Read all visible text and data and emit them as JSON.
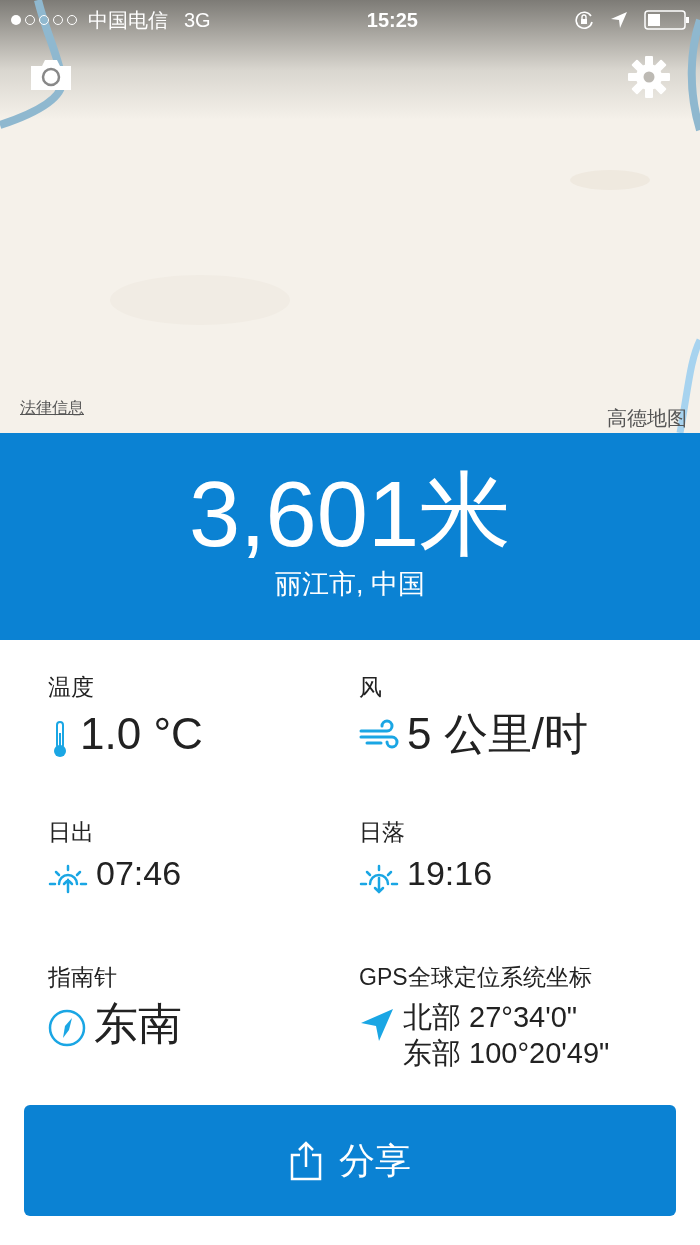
{
  "status_bar": {
    "carrier": "中国电信",
    "network": "3G",
    "time": "15:25"
  },
  "map": {
    "kind": "picture",
    "legal_link": "法律信息",
    "provider_logo": "高德地图"
  },
  "altitude": {
    "value": "3,601米",
    "location": "丽江市, 中国"
  },
  "stats": [
    {
      "kind": "temperature",
      "label": "温度",
      "values": [
        "1.0 °C"
      ]
    },
    {
      "kind": "wind",
      "label": "风",
      "values": [
        "5 公里/时"
      ]
    },
    {
      "kind": "sunrise",
      "label": "日出",
      "values": [
        "07:46"
      ]
    },
    {
      "kind": "sunset",
      "label": "日落",
      "values": [
        "19:16"
      ]
    },
    {
      "kind": "compass",
      "label": "指南针",
      "values": [
        "东南"
      ]
    },
    {
      "kind": "gps",
      "label": "GPS全球定位系统坐标",
      "values": [
        "北部 27°34'0\"",
        "东部 100°20'49\""
      ]
    }
  ],
  "share_button": {
    "label": "分享"
  }
}
